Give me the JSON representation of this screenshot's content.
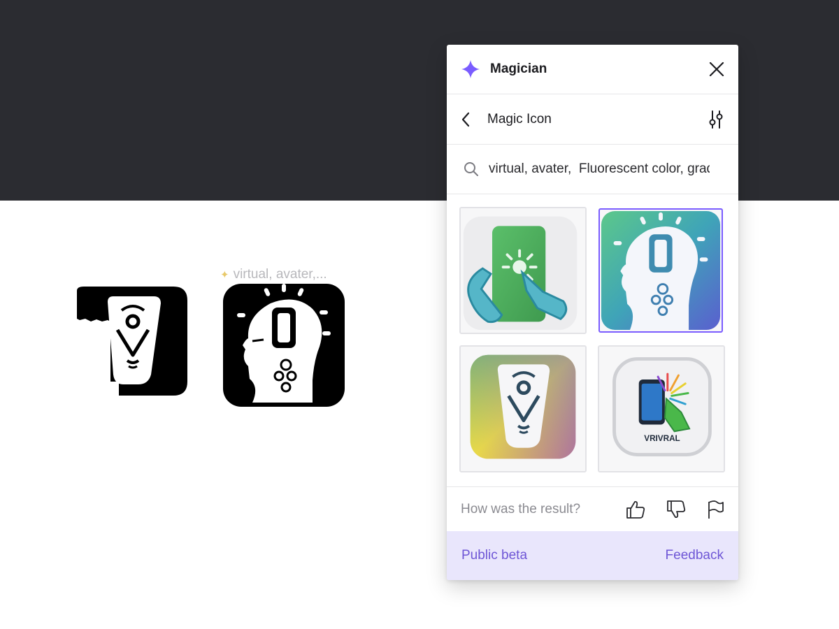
{
  "canvas": {
    "generated_label": "virtual, avater,...",
    "colors": {
      "dark_bg": "#2b2c31",
      "light_bg": "#ffffff"
    }
  },
  "panel": {
    "header": {
      "title": "Magician",
      "logo_icon": "sparkle-icon",
      "close_icon": "close-icon"
    },
    "nav": {
      "title": "Magic Icon",
      "back_icon": "chevron-left-icon",
      "settings_icon": "sliders-icon"
    },
    "search": {
      "value": "virtual, avater,  Fluorescent color, gradient",
      "placeholder": ""
    },
    "results": [
      {
        "name": "phone-touch-hand",
        "selected": false
      },
      {
        "name": "head-profile-gradient",
        "selected": true
      },
      {
        "name": "location-pin-gradient",
        "selected": false
      },
      {
        "name": "phone-finger-vrivral",
        "selected": false,
        "caption": "VRIVRAL"
      }
    ],
    "feedback": {
      "question": "How was the result?"
    },
    "footer": {
      "beta_label": "Public beta",
      "feedback_label": "Feedback"
    },
    "colors": {
      "accent": "#7a5cff",
      "footer_bg": "#e9e6fc",
      "footer_text": "#6e56d6"
    }
  }
}
